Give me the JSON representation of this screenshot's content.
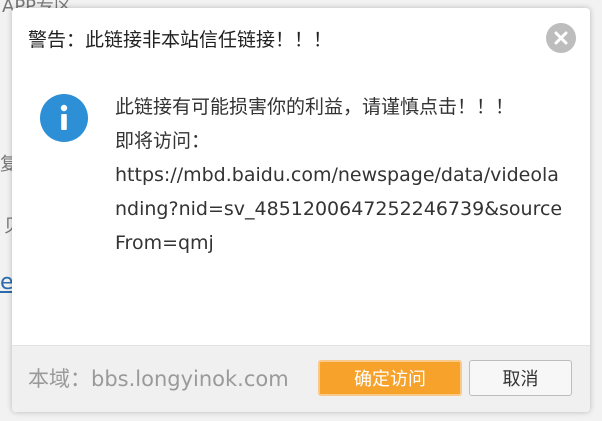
{
  "background": {
    "fragment_1": "APP专区",
    "fragment_2": "复",
    "fragment_3": "贝",
    "fragment_4": "e"
  },
  "dialog": {
    "title": "警告：此链接非本站信任链接！！！",
    "close_icon": "close-icon",
    "info_icon": "info-icon",
    "message_warning": "此链接有可能损害你的利益，请谨慎点击！！！",
    "message_visit_label": "即将访问：",
    "message_url": "https://mbd.baidu.com/newspage/data/videolanding?nid=sv_4851200647252246739&sourceFrom=qmj",
    "domain_label": "本域：bbs.longyinok.com",
    "confirm_label": "确定访问",
    "cancel_label": "取消"
  },
  "colors": {
    "info_blue": "#2d8fd5",
    "confirm_orange": "#f7a22b",
    "close_gray": "#bdbdbd"
  }
}
